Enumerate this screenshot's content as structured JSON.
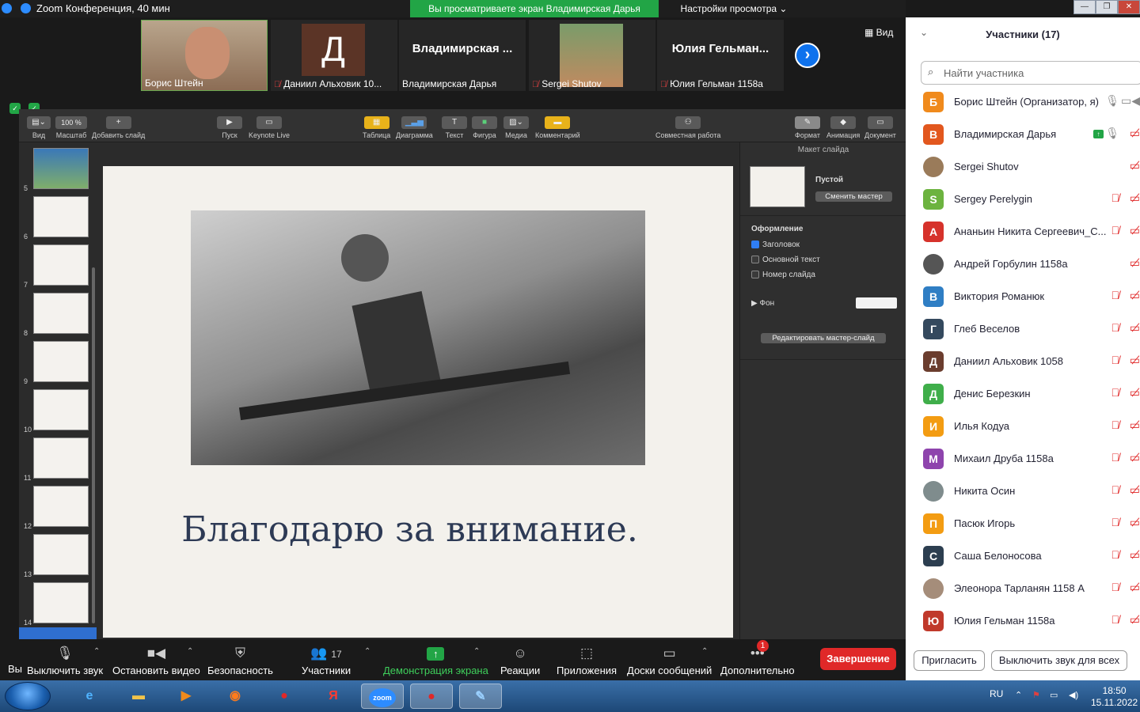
{
  "window": {
    "title": "Zoom Конференция, 40 мин",
    "share_banner": "Вы просматриваете экран Владимирская Дарья",
    "view_settings": "Настройки просмотра",
    "min": "—",
    "max": "❐",
    "close": "✕"
  },
  "strip": {
    "tiles": [
      {
        "name": "Борис Штейн",
        "initial": ""
      },
      {
        "name": "Даниил Альховик 10...",
        "initial": "Д"
      },
      {
        "name": "Владимирская Дарья",
        "big": "Владимирская ..."
      },
      {
        "name": "Sergei Shutov",
        "initial": ""
      },
      {
        "name": "Юлия Гельман 1158а",
        "big": "Юлия  Гельман..."
      }
    ],
    "view_label": "Вид"
  },
  "keynote": {
    "toolbar": {
      "view": "Вид",
      "zoom": "Масштаб",
      "zoom_value": "100 %",
      "add_slide": "Добавить слайд",
      "play": "Пуск",
      "keynote_live": "Keynote Live",
      "table": "Таблица",
      "chart": "Диаграмма",
      "text": "Текст",
      "shape": "Фигура",
      "media": "Медиа",
      "comment": "Комментарий",
      "collab": "Совместная работа",
      "format": "Формат",
      "animate": "Анимация",
      "document": "Документ",
      "text_glyph": "T"
    },
    "slide_numbers": [
      "5",
      "6",
      "7",
      "8",
      "9",
      "10",
      "11",
      "12",
      "13",
      "14"
    ],
    "slide_text": "Благодарю за внимание.",
    "inspector": {
      "section": "Макет слайда",
      "layout_name": "Пустой",
      "change_master": "Сменить мастер",
      "appearance": "Оформление",
      "title_cb": "Заголовок",
      "body_cb": "Основной текст",
      "slide_num_cb": "Номер слайда",
      "background": "Фон",
      "edit_master": "Редактировать мастер-слайд"
    }
  },
  "bottom": {
    "vi": "Вы",
    "mute": "Выключить звук",
    "stop_video": "Остановить видео",
    "security": "Безопасность",
    "participants": "Участники",
    "participants_count": "17",
    "share": "Демонстрация экрана",
    "reactions": "Реакции",
    "apps": "Приложения",
    "whiteboards": "Доски сообщений",
    "more": "Дополнительно",
    "more_badge": "1",
    "end": "Завершение"
  },
  "panel": {
    "title": "Участники (17)",
    "search_placeholder": "Найти участника",
    "participants": [
      {
        "initial": "Б",
        "name": "Борис Штейн (Организатор, я)",
        "color": "#f08a1c"
      },
      {
        "initial": "В",
        "name": "Владимирская Дарья",
        "color": "#e2571e"
      },
      {
        "initial": "",
        "name": "Sergei Shutov",
        "color": "#9a7b5a"
      },
      {
        "initial": "S",
        "name": "Sergey Perelygin",
        "color": "#6cb33f"
      },
      {
        "initial": "А",
        "name": "Ананьин Никита Сергеевич_С...",
        "color": "#d6322b"
      },
      {
        "initial": "",
        "name": "Андрей Горбулин 1158а",
        "color": "#555555"
      },
      {
        "initial": "В",
        "name": "Виктория Романюк",
        "color": "#2f7ec4"
      },
      {
        "initial": "Г",
        "name": "Глеб Веселов",
        "color": "#34495e"
      },
      {
        "initial": "Д",
        "name": "Даниил Альховик 1058",
        "color": "#6b3d2e"
      },
      {
        "initial": "Д",
        "name": "Денис Березкин",
        "color": "#3fae4a"
      },
      {
        "initial": "И",
        "name": "Илья Кодуа",
        "color": "#f39c12"
      },
      {
        "initial": "М",
        "name": "Михаил Друба 1158а",
        "color": "#8e44ad"
      },
      {
        "initial": "",
        "name": "Никита Осин",
        "color": "#7f8c8d"
      },
      {
        "initial": "П",
        "name": "Пасюк Игорь",
        "color": "#f39c12"
      },
      {
        "initial": "С",
        "name": "Саша Белоносова",
        "color": "#2c3e50"
      },
      {
        "initial": "",
        "name": "Элеонора Тарланян 1158 А",
        "color": "#a58d7a"
      },
      {
        "initial": "Ю",
        "name": "Юлия Гельман 1158а",
        "color": "#c0392b"
      }
    ],
    "invite": "Пригласить",
    "mute_all": "Выключить звук для всех"
  },
  "taskbar": {
    "lang": "RU",
    "time": "18:50",
    "date": "15.11.2022",
    "zoom_label": "zoom",
    "yandex": "Я"
  }
}
